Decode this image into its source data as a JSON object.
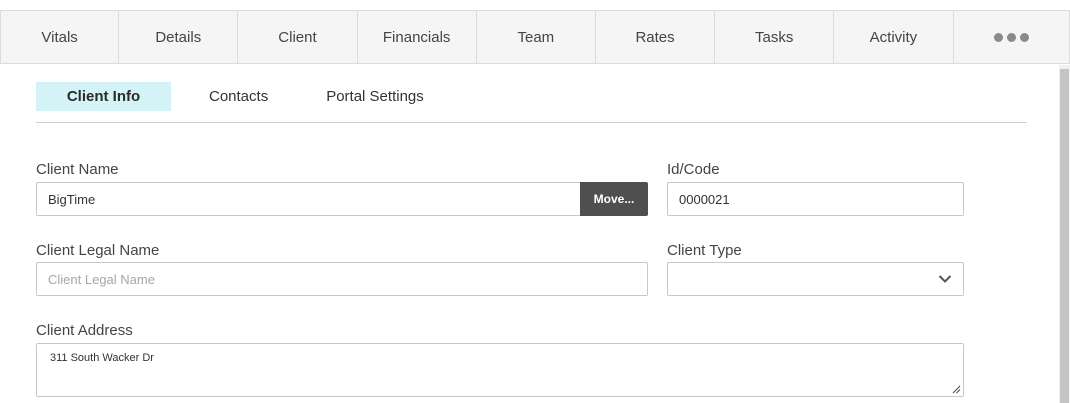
{
  "top_tabs": [
    {
      "label": "Vitals"
    },
    {
      "label": "Details"
    },
    {
      "label": "Client"
    },
    {
      "label": "Financials"
    },
    {
      "label": "Team"
    },
    {
      "label": "Rates"
    },
    {
      "label": "Tasks"
    },
    {
      "label": "Activity"
    }
  ],
  "more_icon": "more-horizontal-icon",
  "sub_tabs": [
    {
      "label": "Client Info",
      "active": true
    },
    {
      "label": "Contacts",
      "active": false
    },
    {
      "label": "Portal Settings",
      "active": false
    }
  ],
  "form": {
    "client_name": {
      "label": "Client Name",
      "value": "BigTime"
    },
    "move_button": "Move...",
    "id_code": {
      "label": "Id/Code",
      "value": "0000021"
    },
    "client_legal_name": {
      "label": "Client Legal Name",
      "value": "",
      "placeholder": "Client Legal Name"
    },
    "client_type": {
      "label": "Client Type",
      "value": ""
    },
    "client_address": {
      "label": "Client Address",
      "value": "311 South Wacker Dr"
    }
  },
  "colors": {
    "active_subtab_bg": "#d4f3f6",
    "move_button_bg": "#4f4f4f",
    "tab_bar_bg": "#f5f5f5"
  }
}
